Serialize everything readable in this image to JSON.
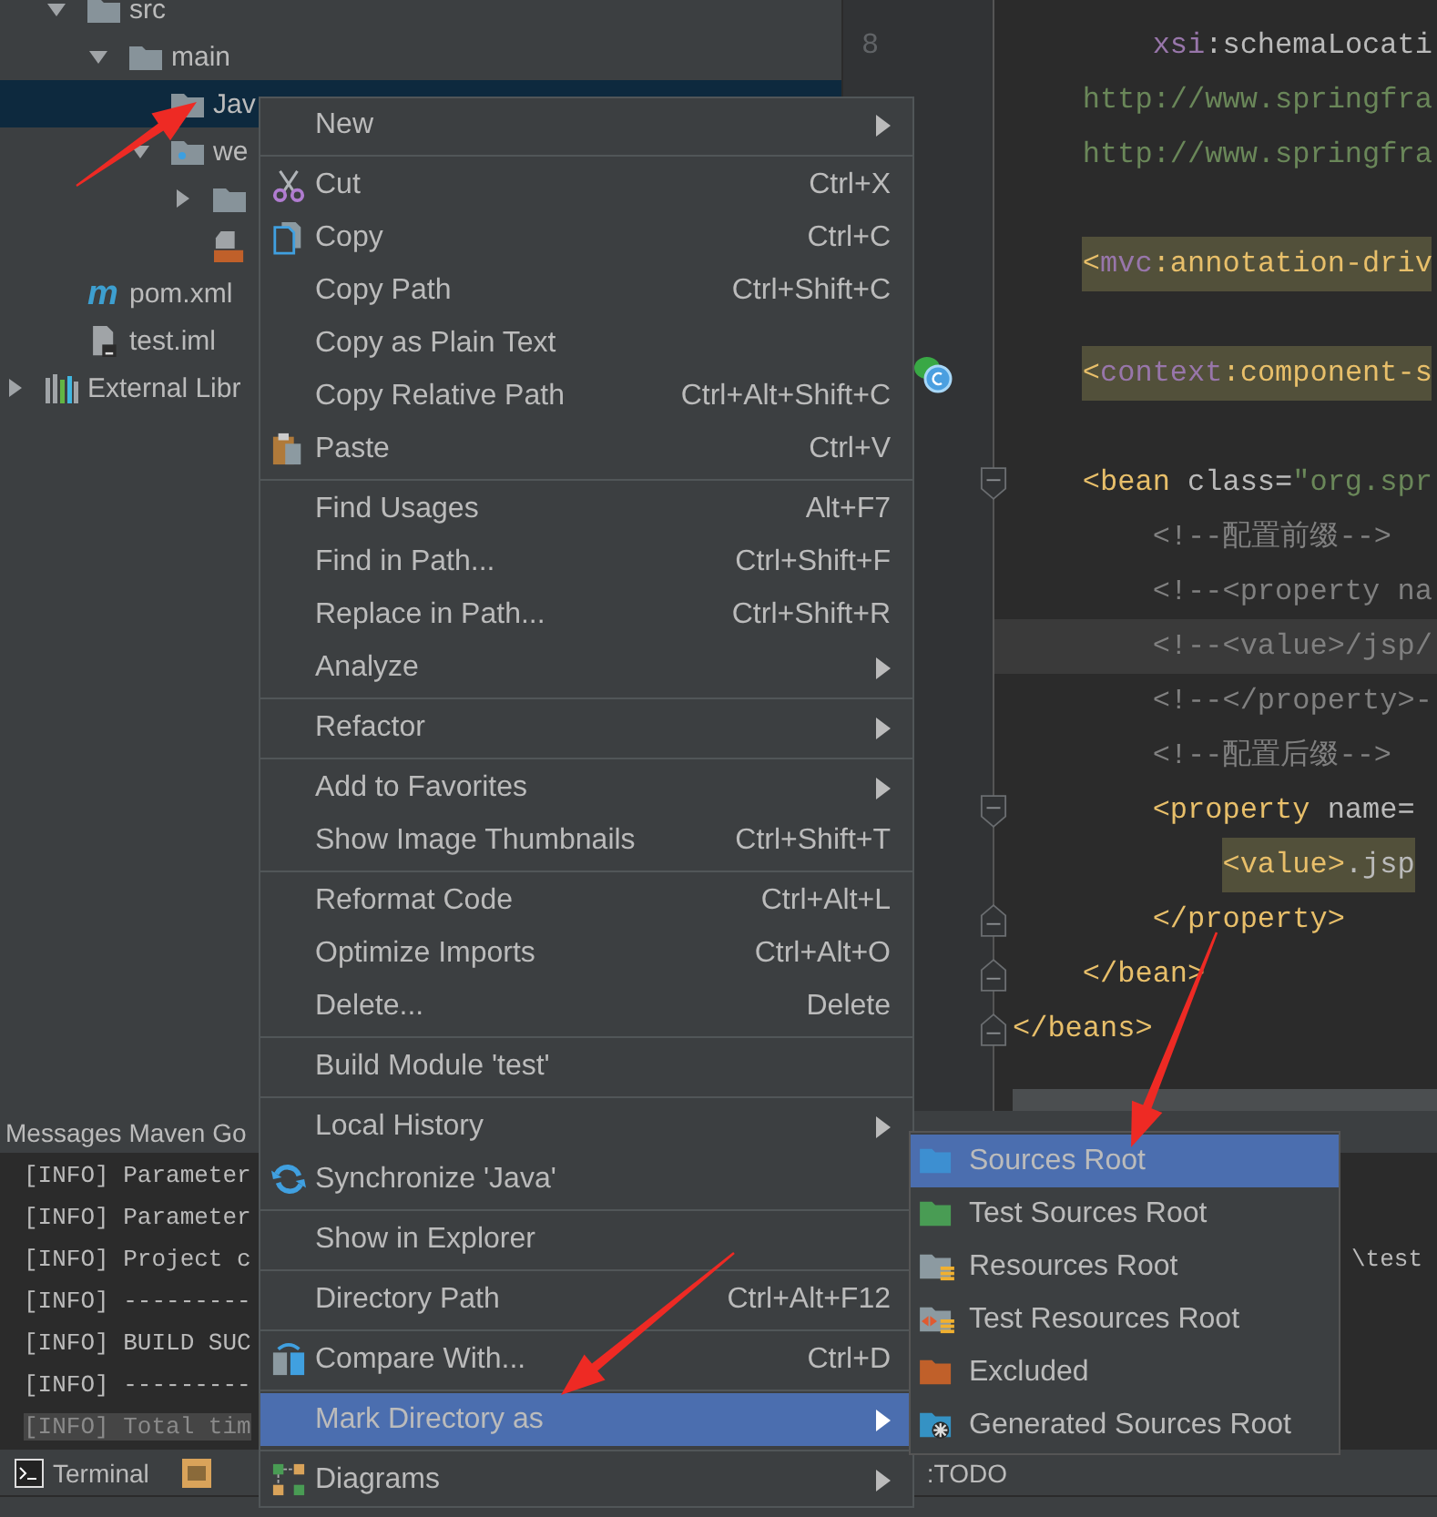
{
  "project": {
    "tree": [
      {
        "label": "src",
        "kind": "folder",
        "expanded": true,
        "selected": false,
        "children": [
          {
            "label": "main",
            "kind": "folder",
            "expanded": true,
            "selected": false,
            "children": [
              {
                "label": "Jav",
                "kind": "folder",
                "selected": true
              },
              {
                "label": "we",
                "kind": "web_folder",
                "expanded": true,
                "selected": false,
                "children": [
                  {
                    "kind": "folder",
                    "expanded": false,
                    "selected": false
                  },
                  {
                    "kind": "jsp_file",
                    "selected": false
                  }
                ]
              }
            ]
          }
        ]
      },
      {
        "label": "pom.xml",
        "kind": "maven_file",
        "badge": "m",
        "selected": false
      },
      {
        "label": "test.iml",
        "kind": "module_file",
        "selected": false
      }
    ],
    "libraries": {
      "label": "External Libr",
      "kind": "library",
      "expanded": false
    }
  },
  "editor": {
    "lines": [
      {
        "number": "8",
        "segments": [
          {
            "text": "        xsi",
            "kind": "prefix"
          },
          {
            "text": ":schemaLocati",
            "kind": "attr"
          }
        ]
      },
      {
        "segments": [
          {
            "text": "    http://www.springfra",
            "kind": "string"
          }
        ]
      },
      {
        "segments": [
          {
            "text": "    http://www.springfra",
            "kind": "string"
          }
        ]
      },
      {
        "blank_before": true,
        "highlighted": true,
        "segments": [
          {
            "text": "    <",
            "kind": "tag"
          },
          {
            "text": "mvc",
            "kind": "prefix"
          },
          {
            "text": ":annotation-driv",
            "kind": "tag"
          }
        ]
      },
      {
        "blank_before": true,
        "highlighted": true,
        "bean_marker": true,
        "segments": [
          {
            "text": "    <",
            "kind": "tag"
          },
          {
            "text": "context",
            "kind": "prefix"
          },
          {
            "text": ":component-s",
            "kind": "tag"
          }
        ]
      },
      {
        "blank_before": true,
        "fold_start": true,
        "segments": [
          {
            "text": "    <bean ",
            "kind": "tag"
          },
          {
            "text": "class=",
            "kind": "attr"
          },
          {
            "text": "\"org.spr",
            "kind": "string"
          }
        ]
      },
      {
        "segments": [
          {
            "text": "        <!--配置前缀-->",
            "kind": "comment"
          }
        ]
      },
      {
        "segments": [
          {
            "text": "        <!--<property na",
            "kind": "comment"
          }
        ]
      },
      {
        "current": true,
        "segments": [
          {
            "text": "        <!--<value>/jsp/",
            "kind": "comment"
          }
        ]
      },
      {
        "segments": [
          {
            "text": "        <!--</property>-",
            "kind": "comment"
          }
        ]
      },
      {
        "segments": [
          {
            "text": "        <!--配置后缀-->",
            "kind": "comment"
          }
        ]
      },
      {
        "fold_start": true,
        "segments": [
          {
            "text": "        <property ",
            "kind": "tag"
          },
          {
            "text": "name=",
            "kind": "attr"
          }
        ]
      },
      {
        "highlighted": true,
        "segments": [
          {
            "text": "            <value>",
            "kind": "tag"
          },
          {
            "text": ".jsp",
            "kind": "attr"
          }
        ]
      },
      {
        "fold_end": true,
        "segments": [
          {
            "text": "        </property>",
            "kind": "tag"
          }
        ]
      },
      {
        "fold_end": true,
        "segments": [
          {
            "text": "    </bean>",
            "kind": "tag"
          }
        ]
      },
      {
        "fold_end": true,
        "segments": [
          {
            "text": "</beans>",
            "kind": "tag"
          }
        ]
      }
    ]
  },
  "messages": {
    "title": "Messages Maven Go",
    "lines": [
      {
        "text": "[INFO] Parameter",
        "highlighted": false
      },
      {
        "text": "[INFO] Parameter",
        "highlighted": false
      },
      {
        "text": "[INFO] Project c",
        "tail": "\\test",
        "highlighted": false
      },
      {
        "text": "[INFO] ---------",
        "highlighted": false
      },
      {
        "text": "[INFO] BUILD SUC",
        "highlighted": false
      },
      {
        "text": "[INFO] ---------",
        "highlighted": false
      },
      {
        "text": "[INFO] Total tim",
        "highlighted": true
      }
    ]
  },
  "tool_tabs": [
    {
      "label": "Terminal",
      "kind": "terminal"
    },
    {
      "kind": "output"
    },
    {
      "label": ":TODO",
      "kind": "todo"
    }
  ],
  "context_menu": {
    "groups": [
      [
        {
          "label": "New",
          "submenu": true,
          "selected": false
        }
      ],
      [
        {
          "label": "Cut",
          "shortcut": "Ctrl+X",
          "kind": "cut",
          "selected": false
        },
        {
          "label": "Copy",
          "shortcut": "Ctrl+C",
          "kind": "copy",
          "selected": false
        },
        {
          "label": "Copy Path",
          "shortcut": "Ctrl+Shift+C",
          "selected": false
        },
        {
          "label": "Copy as Plain Text",
          "selected": false
        },
        {
          "label": "Copy Relative Path",
          "shortcut": "Ctrl+Alt+Shift+C",
          "selected": false
        },
        {
          "label": "Paste",
          "shortcut": "Ctrl+V",
          "kind": "paste",
          "selected": false
        }
      ],
      [
        {
          "label": "Find Usages",
          "shortcut": "Alt+F7",
          "selected": false
        },
        {
          "label": "Find in Path...",
          "shortcut": "Ctrl+Shift+F",
          "selected": false
        },
        {
          "label": "Replace in Path...",
          "shortcut": "Ctrl+Shift+R",
          "selected": false
        },
        {
          "label": "Analyze",
          "submenu": true,
          "selected": false
        }
      ],
      [
        {
          "label": "Refactor",
          "submenu": true,
          "selected": false
        }
      ],
      [
        {
          "label": "Add to Favorites",
          "submenu": true,
          "selected": false
        },
        {
          "label": "Show Image Thumbnails",
          "shortcut": "Ctrl+Shift+T",
          "selected": false
        }
      ],
      [
        {
          "label": "Reformat Code",
          "shortcut": "Ctrl+Alt+L",
          "selected": false
        },
        {
          "label": "Optimize Imports",
          "shortcut": "Ctrl+Alt+O",
          "selected": false
        },
        {
          "label": "Delete...",
          "shortcut": "Delete",
          "selected": false
        }
      ],
      [
        {
          "label": "Build Module 'test'",
          "selected": false
        }
      ],
      [
        {
          "label": "Local History",
          "submenu": true,
          "selected": false
        },
        {
          "label": "Synchronize 'Java'",
          "kind": "sync",
          "selected": false
        }
      ],
      [
        {
          "label": "Show in Explorer",
          "selected": false
        }
      ],
      [
        {
          "label": "Directory Path",
          "shortcut": "Ctrl+Alt+F12",
          "selected": false
        }
      ],
      [
        {
          "label": "Compare With...",
          "shortcut": "Ctrl+D",
          "kind": "compare",
          "selected": false
        }
      ],
      [
        {
          "label": "Mark Directory as",
          "submenu": true,
          "selected": true
        }
      ],
      [
        {
          "label": "Diagrams",
          "submenu": true,
          "kind": "diagram",
          "selected": false
        }
      ]
    ]
  },
  "submenu": {
    "items": [
      {
        "label": "Sources Root",
        "color": "#3d8fd1",
        "kind": "plain",
        "selected": true
      },
      {
        "label": "Test Sources Root",
        "color": "#499c54",
        "kind": "plain",
        "selected": false
      },
      {
        "label": "Resources Root",
        "color": "#8c9aa1",
        "kind": "resources",
        "selected": false
      },
      {
        "label": "Test Resources Root",
        "color": "#8c9aa1",
        "kind": "test_resources",
        "selected": false
      },
      {
        "label": "Excluded",
        "color": "#c0602a",
        "kind": "plain",
        "selected": false
      },
      {
        "label": "Generated Sources Root",
        "color": "#3592c4",
        "kind": "generated",
        "selected": false
      }
    ]
  }
}
